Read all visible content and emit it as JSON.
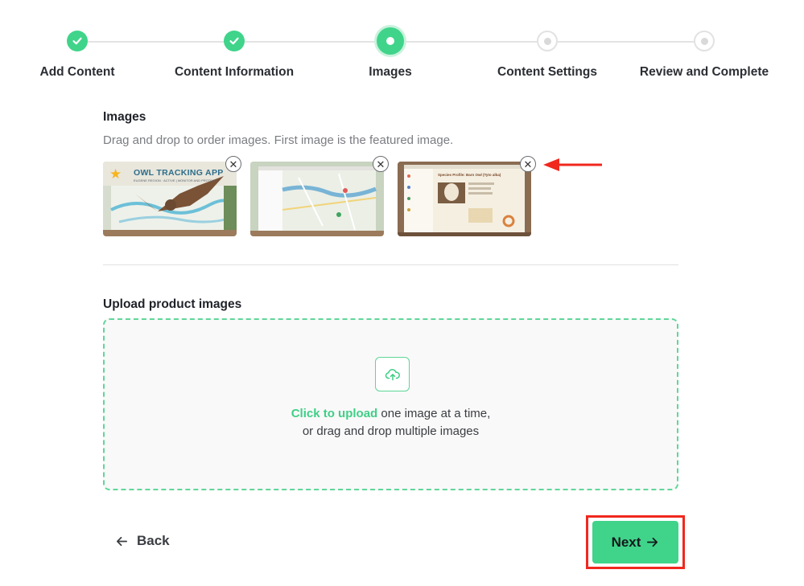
{
  "stepper": {
    "steps": [
      {
        "label": "Add Content",
        "state": "done"
      },
      {
        "label": "Content Information",
        "state": "done"
      },
      {
        "label": "Images",
        "state": "current"
      },
      {
        "label": "Content Settings",
        "state": "todo"
      },
      {
        "label": "Review and Complete",
        "state": "todo"
      }
    ]
  },
  "images": {
    "title": "Images",
    "hint": "Drag and drop to order images. First image is the featured image.",
    "items": [
      {
        "featured": true,
        "caption_title": "OWL TRACKING APP",
        "caption_sub": "EUGENE REGION · ACTIVE | MONITOR AND PROTECT",
        "remove_label": "✕"
      },
      {
        "featured": false,
        "remove_label": "✕"
      },
      {
        "featured": false,
        "caption_title": "Species Profile: Barn Owl (Tyto alba)",
        "remove_label": "✕"
      }
    ]
  },
  "upload": {
    "title": "Upload product images",
    "link_text": "Click to upload",
    "text_line1_rest": " one image at a time,",
    "text_line2": "or drag and drop multiple images"
  },
  "nav": {
    "back_label": "Back",
    "next_label": "Next"
  },
  "colors": {
    "accent": "#3fd48a",
    "highlight": "#f0281e"
  }
}
